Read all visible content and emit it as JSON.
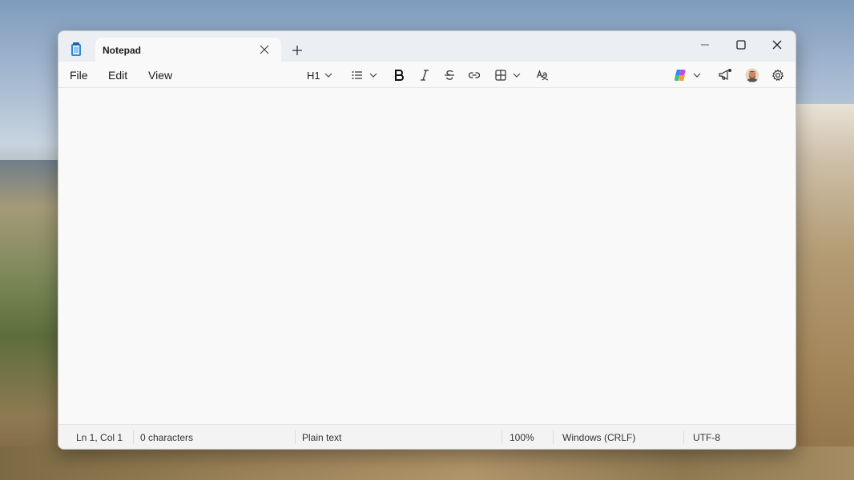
{
  "window": {
    "tab_title": "Notepad"
  },
  "menu": {
    "file": "File",
    "edit": "Edit",
    "view": "View"
  },
  "toolbar": {
    "heading_label": "H1"
  },
  "status": {
    "position": "Ln 1, Col 1",
    "characters": "0 characters",
    "format": "Plain text",
    "zoom": "100%",
    "line_ending": "Windows (CRLF)",
    "encoding": "UTF-8"
  },
  "icons": {
    "app": "notepad-icon",
    "close_tab": "close-icon",
    "new_tab": "plus-icon",
    "minimize": "minimize-icon",
    "maximize": "maximize-icon",
    "close_window": "close-icon",
    "list": "bullet-list-icon",
    "bold": "bold-icon",
    "italic": "italic-icon",
    "strikethrough": "strikethrough-icon",
    "link": "link-icon",
    "table": "table-icon",
    "spellcheck": "spellcheck-icon",
    "copilot": "copilot-icon",
    "whats_new": "megaphone-icon",
    "avatar": "avatar",
    "settings": "gear-icon"
  },
  "colors": {
    "accent": "#1a73e8",
    "titlebar": "#ebeef2",
    "editor_bg": "#f9f9f9"
  }
}
